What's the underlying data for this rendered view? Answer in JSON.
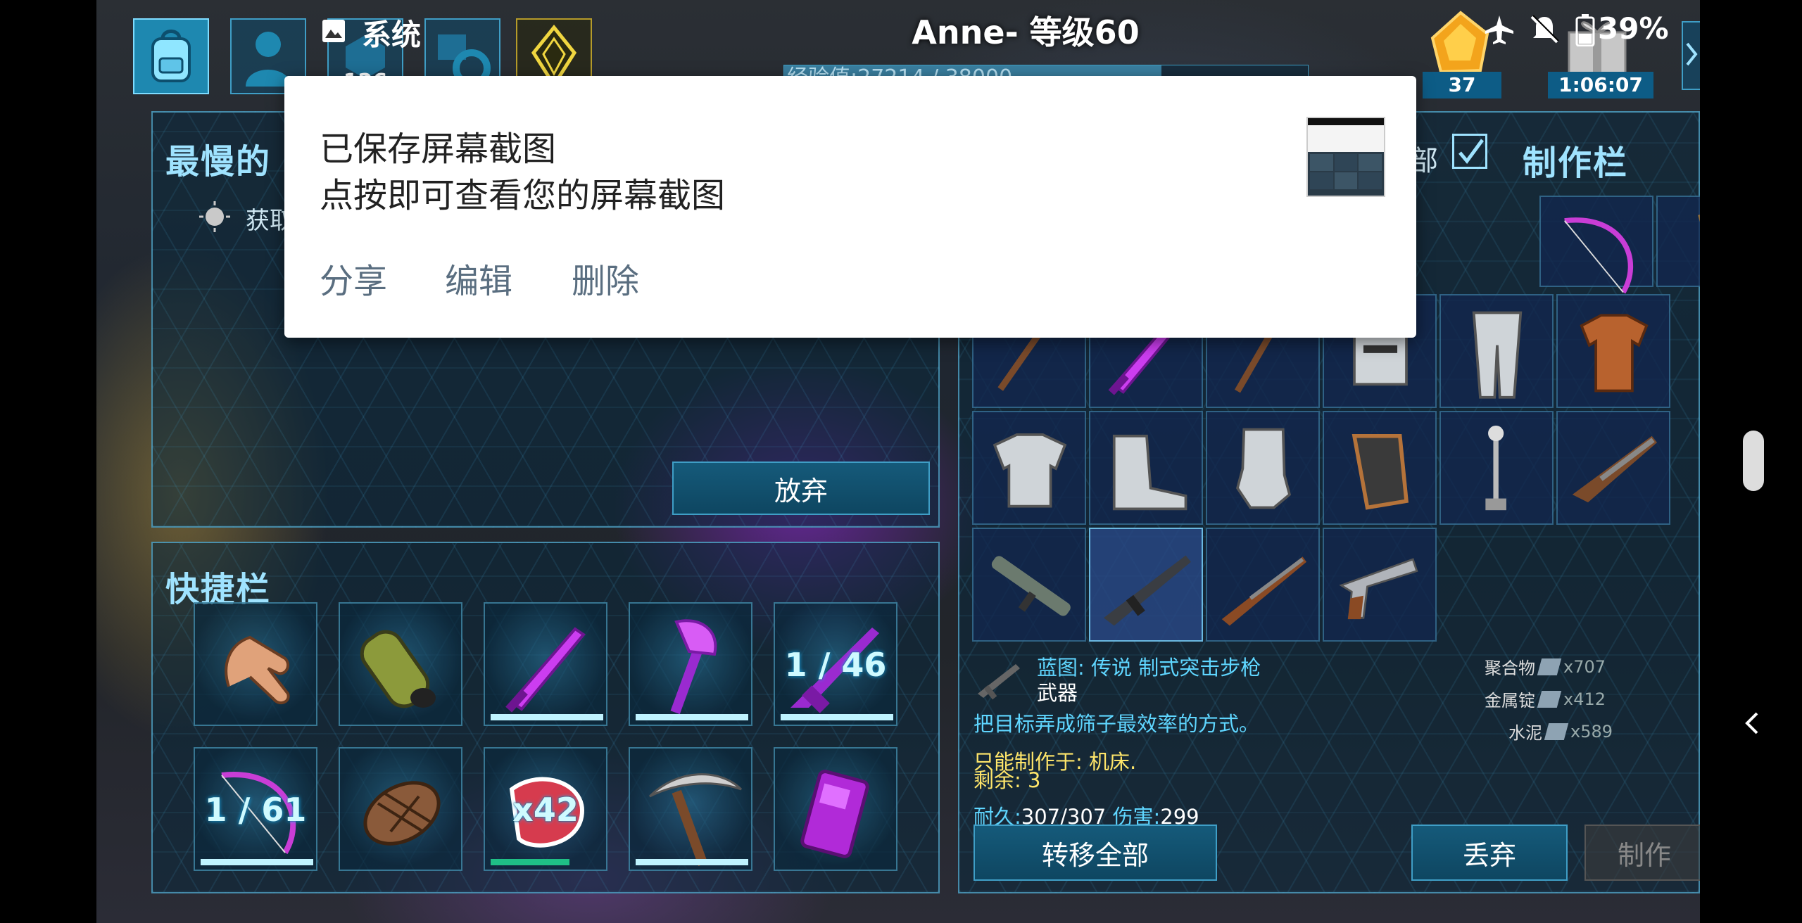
{
  "status_bar": {
    "app_label": "系统",
    "battery": "39%"
  },
  "hud": {
    "player_title": "Anne- 等级60",
    "xp_text": "经验值:27214 / 38000",
    "xp_progress": 0.72,
    "level_points": "126",
    "resource_count": "37",
    "timer": "1:06:07"
  },
  "toast": {
    "line1": "已保存屏幕截图",
    "line2": "点按即可查看您的屏幕截图",
    "actions": [
      "分享",
      "编辑",
      "删除"
    ]
  },
  "left_panel": {
    "title_visible": "最慢的",
    "hint_visible": "获取",
    "abandon_button": "放弃"
  },
  "hotbar": {
    "title": "快捷栏",
    "slots": [
      {
        "icon": "hand-icon",
        "label": "",
        "durability": 0
      },
      {
        "icon": "cloth-armor-roll-icon",
        "label": "",
        "durability": 0
      },
      {
        "icon": "sword-icon",
        "label": "",
        "durability": 1.0
      },
      {
        "icon": "hatchet-icon",
        "label": "",
        "durability": 1.0
      },
      {
        "icon": "rifle-icon",
        "label": "1 / 46",
        "durability": 1.0
      },
      {
        "icon": "bow-icon",
        "label": "1 / 61",
        "durability": 1.0
      },
      {
        "icon": "cooked-meat-icon",
        "label": "",
        "durability": 0
      },
      {
        "icon": "raw-meat-icon",
        "label": "x42",
        "durability": 0.7
      },
      {
        "icon": "pickaxe-icon",
        "label": "",
        "durability": 1.0
      },
      {
        "icon": "radio-icon",
        "label": "",
        "durability": 0
      }
    ]
  },
  "crafting": {
    "title": "制作栏",
    "filter_label_visible": "部",
    "filter_checked": true,
    "items": [
      "spear-icon",
      "sword-icon",
      "pike-icon",
      "metal-helmet-icon",
      "metal-leggings-icon",
      "leather-shirt-icon",
      "metal-chestplate-icon",
      "metal-boots-icon",
      "metal-gloves-icon",
      "riot-gloves-icon",
      "light-post-icon",
      "shotgun-icon",
      "rocket-launcher-icon",
      "assault-rifle-icon",
      "pump-shotgun-icon",
      "revolver-icon"
    ],
    "top_visible": [
      "bow-icon",
      "slingshot-icon"
    ],
    "selected_index": 13,
    "detail": {
      "name": "蓝图: 传说 制式突击步枪",
      "type": "武器",
      "description": "把目标弄成筛子最效率的方式。",
      "craft_only": "只能制作于: 机床.",
      "remaining": "剩余: 3",
      "durability_label": "耐久:",
      "durability_value": "307/307",
      "damage_label": "伤害:",
      "damage_value": "299",
      "requirements": [
        {
          "name": "聚合物",
          "amount": "x707"
        },
        {
          "name": "金属锭",
          "amount": "x412"
        },
        {
          "name": "水泥",
          "amount": "x589"
        }
      ]
    },
    "transfer_all": "转移全部",
    "drop": "丢弃",
    "craft": "制作"
  }
}
